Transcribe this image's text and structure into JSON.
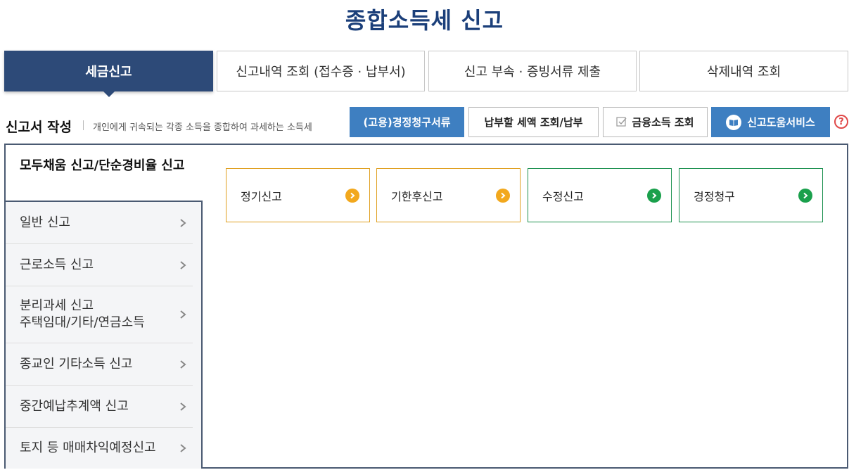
{
  "page": {
    "title": "종합소득세 신고"
  },
  "tabs": [
    {
      "label": "세금신고",
      "active": true
    },
    {
      "label": "신고내역 조회 (접수증 · 납부서)"
    },
    {
      "label": "신고 부속 · 증빙서류 제출"
    },
    {
      "label": "삭제내역 조회"
    }
  ],
  "section": {
    "heading": "신고서 작성",
    "description": "개인에게 귀속되는 각종 소득을 종합하여 과세하는 소득세"
  },
  "actions": {
    "claim_docs": "(고용)경정청구서류",
    "tax_payment": "납부할 세액 조회/납부",
    "financial_income": "금융소득 조회",
    "help_service": "신고도움서비스",
    "help_mark": "?"
  },
  "sidebar": {
    "active": "모두채움 신고/단순경비율 신고",
    "items": [
      {
        "label": "일반 신고"
      },
      {
        "label": "근로소득 신고"
      },
      {
        "label": "분리과세 신고\n주택임대/기타/연금소득"
      },
      {
        "label": "종교인 기타소득 신고"
      },
      {
        "label": "중간예납추계액 신고"
      },
      {
        "label": "토지 등 매매차익예정신고"
      }
    ]
  },
  "cards": [
    {
      "label": "정기신고",
      "color": "#f2a81d"
    },
    {
      "label": "기한후신고",
      "color": "#f2a81d"
    },
    {
      "label": "수정신고",
      "color": "#1aa04c"
    },
    {
      "label": "경정청구",
      "color": "#1aa04c"
    }
  ],
  "colors": {
    "title": "#1b3f7a",
    "tab_active": "#2d4a78",
    "button_blue": "#3e7fc1",
    "panel_border": "#4a5a72",
    "card_orange": "#e0a020",
    "card_green": "#1e9150"
  }
}
